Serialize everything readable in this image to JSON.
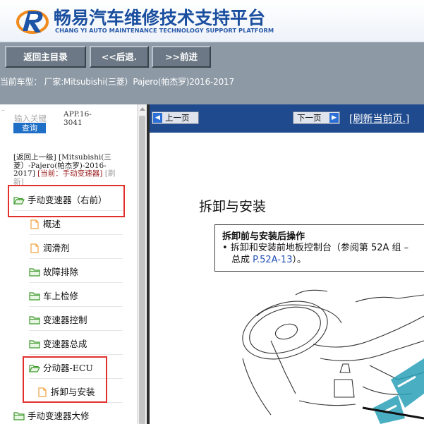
{
  "header": {
    "title": "畅易汽车维修技术支持平台",
    "subtitle": "CHANG YI AUTO MAINTENANCE TECHNOLOGY SUPPORT PLATFORM"
  },
  "toolbar": {
    "home_label": "返回主目录",
    "back_label": "<<后退.",
    "forward_label": ">>前进"
  },
  "model_bar": {
    "text": "当前车型： 厂家:Mitsubishi(三菱）Pajero(帕杰罗)2016-2017"
  },
  "sidebar": {
    "search_placeholder": "输入关键",
    "search_button": "查询",
    "doc_code": "APP.16-3041",
    "breadcrumb_parent": "[返回上一级] [Mitsubishi(三菱）-Pajero(帕杰罗)-2016-2017]",
    "breadcrumb_current": "[当前：手动变速器]",
    "breadcrumb_refresh": "[刷新]",
    "tree": [
      {
        "label": "手动变速器（右前）",
        "icon": "folder-open-icon"
      },
      {
        "label": "概述",
        "icon": "document-icon"
      },
      {
        "label": "润滑剂",
        "icon": "document-icon"
      },
      {
        "label": "故障排除",
        "icon": "folder-icon"
      },
      {
        "label": "车上检修",
        "icon": "folder-icon"
      },
      {
        "label": "变速器控制",
        "icon": "folder-icon"
      },
      {
        "label": "变速器总成",
        "icon": "folder-icon"
      },
      {
        "label": "分动器-ECU",
        "icon": "folder-open-icon"
      },
      {
        "label": "拆卸与安装",
        "icon": "document-icon"
      },
      {
        "label": "手动变速器大修",
        "icon": "folder-icon"
      }
    ]
  },
  "pager": {
    "prev_label": "上一页",
    "next_label": "下一页",
    "refresh_label": "[刷新当前页.]"
  },
  "document": {
    "title": "拆卸与安装",
    "note_heading": "拆卸前与安装后操作",
    "note_bullet": "•",
    "note_text_1": "拆卸和安装前地板控制台（参阅第 52A 组 –",
    "note_text_2": "总成 ",
    "note_ref": "P.52A-13",
    "note_text_3": "）。"
  },
  "colors": {
    "toolbar_bg": "#8d99a5",
    "pager_bg": "#1f4a8e",
    "highlight_box": "#e2312d",
    "brand_blue": "#1a4e9e"
  }
}
